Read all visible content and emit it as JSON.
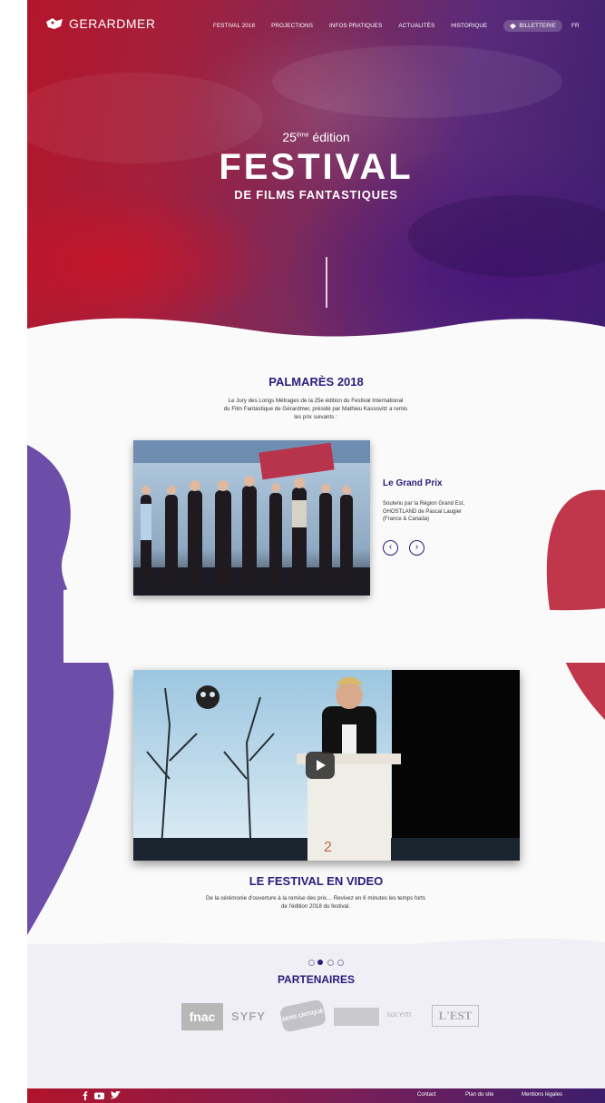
{
  "brand": {
    "name": "GERARDMER"
  },
  "nav": {
    "items": [
      "FESTIVAL 2018",
      "PROJECTIONS",
      "INFOS PRATIQUES",
      "ACTUALITÉS",
      "HISTORIQUE"
    ],
    "ticket": "BILLETTERIE",
    "lang": "FR"
  },
  "hero": {
    "edition_number": "25",
    "edition_sup": "ème",
    "edition_word": " édition",
    "title": "FESTIVAL",
    "subtitle": "DE FILMS FANTASTIQUES"
  },
  "palmares": {
    "title": "PALMARÈS 2018",
    "intro_lines": [
      "Le Jury des Longs Métrages de la 25e édition du Festival International",
      "du Film Fantastique de Gérardmer, présidé par Mathieu Kassovitz a remis",
      "les prix suivants :"
    ],
    "prize_title": "Le Grand Prix",
    "prize_lines": [
      "Soutenu par la Région Grand Est,",
      "GHOSTLAND de Pascal Laugier",
      "(France & Canada)"
    ],
    "prev": "‹",
    "next": "›"
  },
  "video": {
    "title": "LE FESTIVAL EN VIDEO",
    "text_lines": [
      "De la cérémonie d'ouverture à la remise des prix… Revivez en 6 minutes les temps forts",
      "de l'édition 2018 du festival."
    ]
  },
  "partners": {
    "title": "PARTENAIRES",
    "logos": [
      "fnac",
      "SYFY",
      "SENS CRITIQUE",
      "sacem",
      "L'EST"
    ]
  },
  "footer": {
    "links": [
      "Contact",
      "Plan du site",
      "Mentions légales"
    ]
  },
  "colors": {
    "title_purple": "#2d1b7a",
    "red": "#c0263f",
    "purple": "#5b3a9a"
  }
}
